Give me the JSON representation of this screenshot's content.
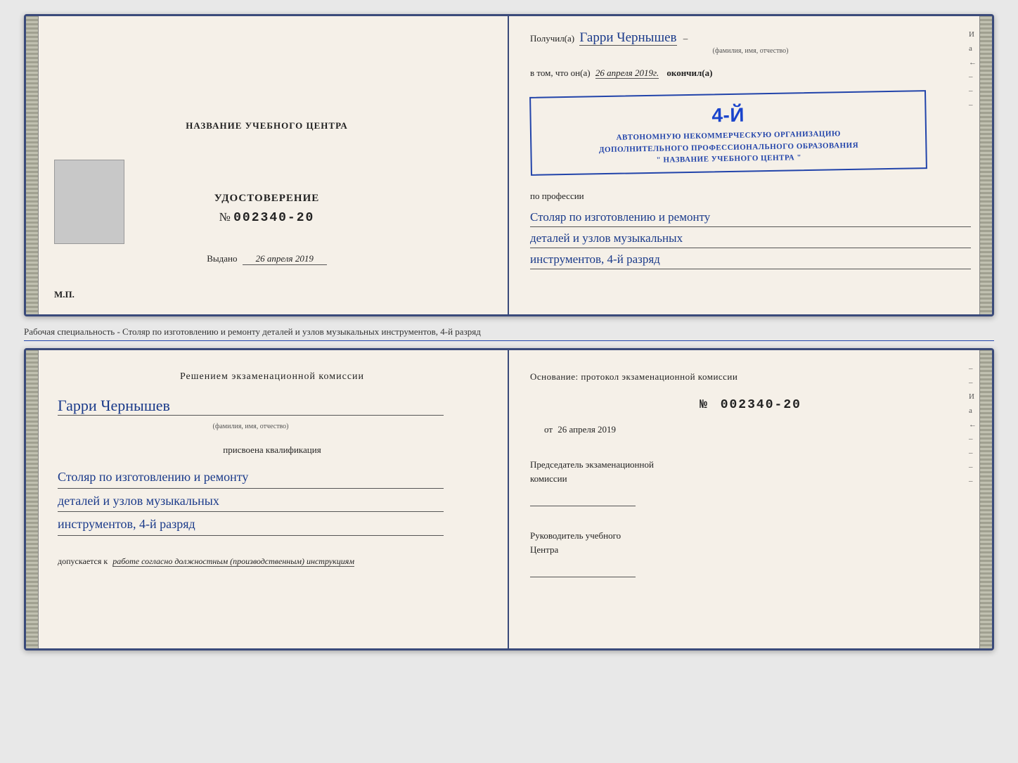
{
  "page": {
    "background": "#e8e8e8"
  },
  "specialty_label": "Рабочая специальность - Столяр по изготовлению и ремонту деталей и узлов музыкальных инструментов, 4-й разряд",
  "doc_top": {
    "left": {
      "institution_title": "НАЗВАНИЕ УЧЕБНОГО ЦЕНТРА",
      "photo_alt": "фото",
      "cert_title": "УДОСТОВЕРЕНИЕ",
      "cert_number_prefix": "№",
      "cert_number": "002340-20",
      "issued_label": "Выдано",
      "issued_date": "26 апреля 2019",
      "mp_label": "М.П."
    },
    "right": {
      "received_prefix": "Получил(а)",
      "received_name": "Гарри Чернышев",
      "received_subtitle": "(фамилия, имя, отчество)",
      "in_that_prefix": "в том, что он(а)",
      "completion_date": "26 апреля 2019г.",
      "dash": "–",
      "finished_label": "окончил(а)",
      "stamp_line1": "АВТОНОМНУЮ НЕКОММЕРЧЕСКУЮ ОРГАНИЗАЦИЮ",
      "stamp_line2": "ДОПОЛНИТЕЛЬНОГО ПРОФЕССИОНАЛЬНОГО ОБРАЗОВАНИЯ",
      "stamp_line3": "\" НАЗВАНИЕ УЧЕБНОГО ЦЕНТРА \"",
      "stamp_big": "4-й",
      "profession_prefix": "по профессии",
      "profession_line1": "Столяр по изготовлению и ремонту",
      "profession_line2": "деталей и узлов музыкальных",
      "profession_line3": "инструментов, 4-й разряд"
    }
  },
  "doc_bottom": {
    "left": {
      "decision_text": "Решением  экзаменационной  комиссии",
      "person_name": "Гарри Чернышев",
      "name_subtitle": "(фамилия, имя, отчество)",
      "qualification_label": "присвоена квалификация",
      "qualification_line1": "Столяр по изготовлению и ремонту",
      "qualification_line2": "деталей и узлов музыкальных",
      "qualification_line3": "инструментов, 4-й разряд",
      "admission_prefix": "допускается к",
      "admission_italic": "работе согласно должностным (производственным) инструкциям"
    },
    "right": {
      "basis_text": "Основание:  протокол  экзаменационной  комиссии",
      "protocol_prefix": "№",
      "protocol_number": "002340-20",
      "date_prefix": "от",
      "date_value": "26 апреля 2019",
      "chairman_label1": "Председатель экзаменационной",
      "chairman_label2": "комиссии",
      "director_label1": "Руководитель учебного",
      "director_label2": "Центра",
      "right_chars": [
        "И",
        "а",
        "←",
        "–",
        "–",
        "–",
        "–"
      ]
    }
  }
}
